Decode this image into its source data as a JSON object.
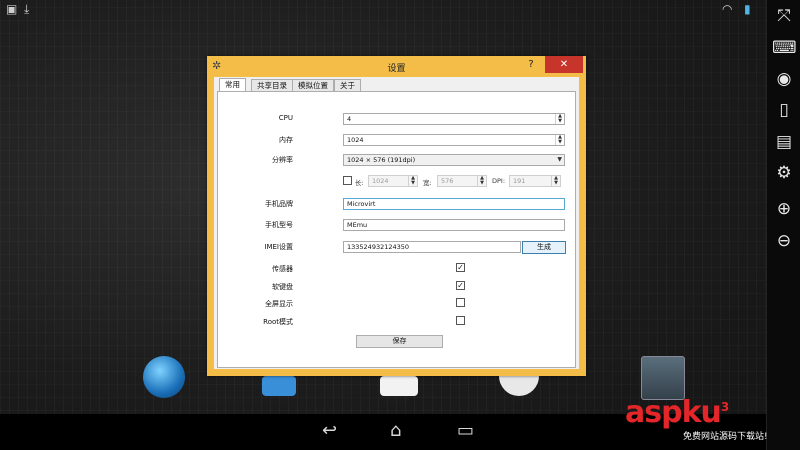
{
  "dialog": {
    "title": "设置",
    "help_label": "?",
    "close_label": "✕",
    "tabs": [
      {
        "label": "常用"
      },
      {
        "label": "共享目录"
      },
      {
        "label": "模拟位置"
      },
      {
        "label": "关于"
      }
    ],
    "form": {
      "cpu": {
        "label": "CPU",
        "value": "4"
      },
      "memory": {
        "label": "内存",
        "value": "1024"
      },
      "resolution": {
        "label": "分辨率",
        "value": "1024 × 576 (191dpi)"
      },
      "custom": {
        "length_label": "长:",
        "length_value": "1024",
        "width_label": "宽:",
        "width_value": "576",
        "dpi_label": "DPI:",
        "dpi_value": "191",
        "checked": false
      },
      "brand": {
        "label": "手机品牌",
        "value": "Microvirt"
      },
      "model": {
        "label": "手机型号",
        "value": "MEmu"
      },
      "imei": {
        "label": "IMEI设置",
        "value": "133524932124350",
        "generate_label": "生成"
      },
      "sensor": {
        "label": "传感器",
        "checked": true
      },
      "soft_keyboard": {
        "label": "软键盘",
        "checked": true
      },
      "fullscreen": {
        "label": "全屏显示",
        "checked": false
      },
      "root": {
        "label": "Root模式",
        "checked": false
      },
      "save_label": "保存"
    }
  },
  "watermark": {
    "text": "aspku",
    "suffix": "3",
    "sub": "免费网站源码下载站!"
  },
  "colors": {
    "dialog_frame": "#f3bd48",
    "close": "#c7352a",
    "accent": "#3c7fb1"
  }
}
